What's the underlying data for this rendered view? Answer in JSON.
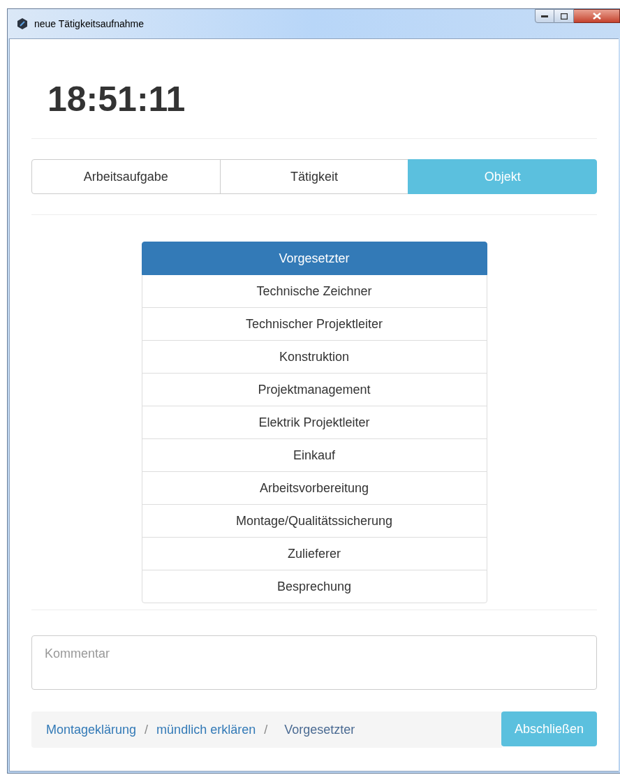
{
  "window": {
    "title": "neue Tätigkeitsaufnahme"
  },
  "clock": "18:51:11",
  "tabs": [
    {
      "label": "Arbeitsaufgabe",
      "selected": false
    },
    {
      "label": "Tätigkeit",
      "selected": false
    },
    {
      "label": "Objekt",
      "selected": true
    }
  ],
  "list": [
    {
      "label": "Vorgesetzter",
      "selected": true
    },
    {
      "label": "Technische Zeichner",
      "selected": false
    },
    {
      "label": "Technischer Projektleiter",
      "selected": false
    },
    {
      "label": "Konstruktion",
      "selected": false
    },
    {
      "label": "Projektmanagement",
      "selected": false
    },
    {
      "label": "Elektrik Projektleiter",
      "selected": false
    },
    {
      "label": "Einkauf",
      "selected": false
    },
    {
      "label": "Arbeitsvorbereitung",
      "selected": false
    },
    {
      "label": "Montage/Qualitätssicherung",
      "selected": false
    },
    {
      "label": "Zulieferer",
      "selected": false
    },
    {
      "label": "Besprechung",
      "selected": false
    }
  ],
  "comment": {
    "placeholder": "Kommentar"
  },
  "breadcrumb": {
    "separator": "/",
    "items": [
      "Montageklärung",
      "mündlich erklären",
      "Vorgesetzter"
    ]
  },
  "finish_button": "Abschließen"
}
